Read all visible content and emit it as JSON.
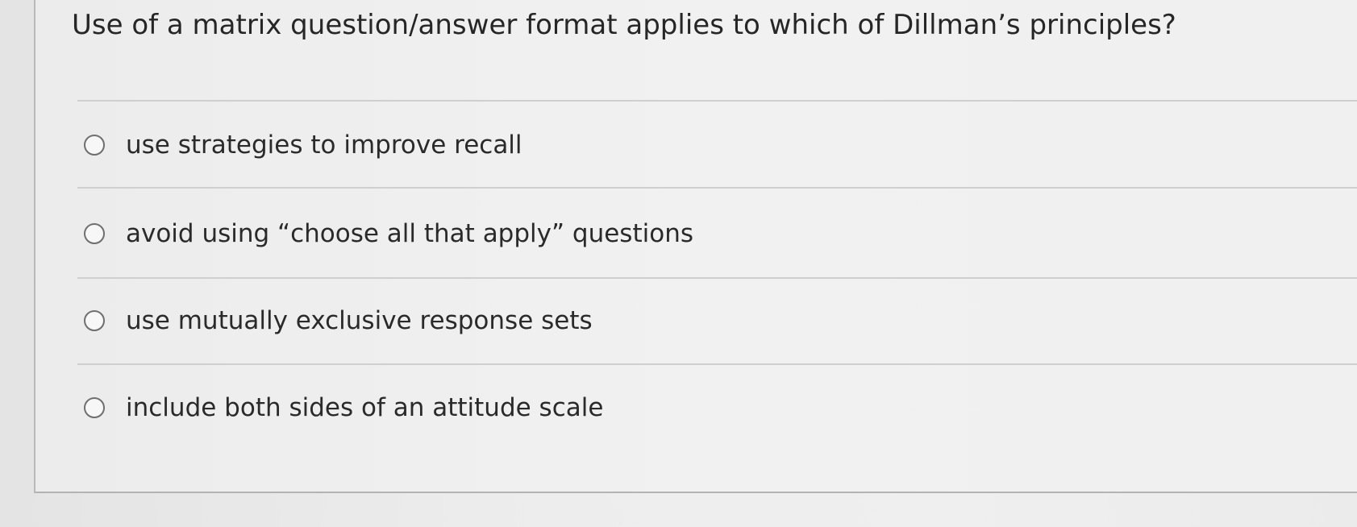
{
  "question": {
    "text": "Use of a matrix question/answer format applies to which of Dillman’s principles?"
  },
  "options": [
    {
      "label": "use strategies to improve recall",
      "selected": false
    },
    {
      "label": "avoid using “choose all that apply” questions",
      "selected": false
    },
    {
      "label": "use mutually exclusive response sets",
      "selected": false
    },
    {
      "label": "include both sides of an attitude scale",
      "selected": false
    }
  ],
  "colors": {
    "background": "#eeeeee",
    "text": "#2a2a2a",
    "radio_border": "#6f6f6f",
    "divider": "#cfcfcf"
  }
}
